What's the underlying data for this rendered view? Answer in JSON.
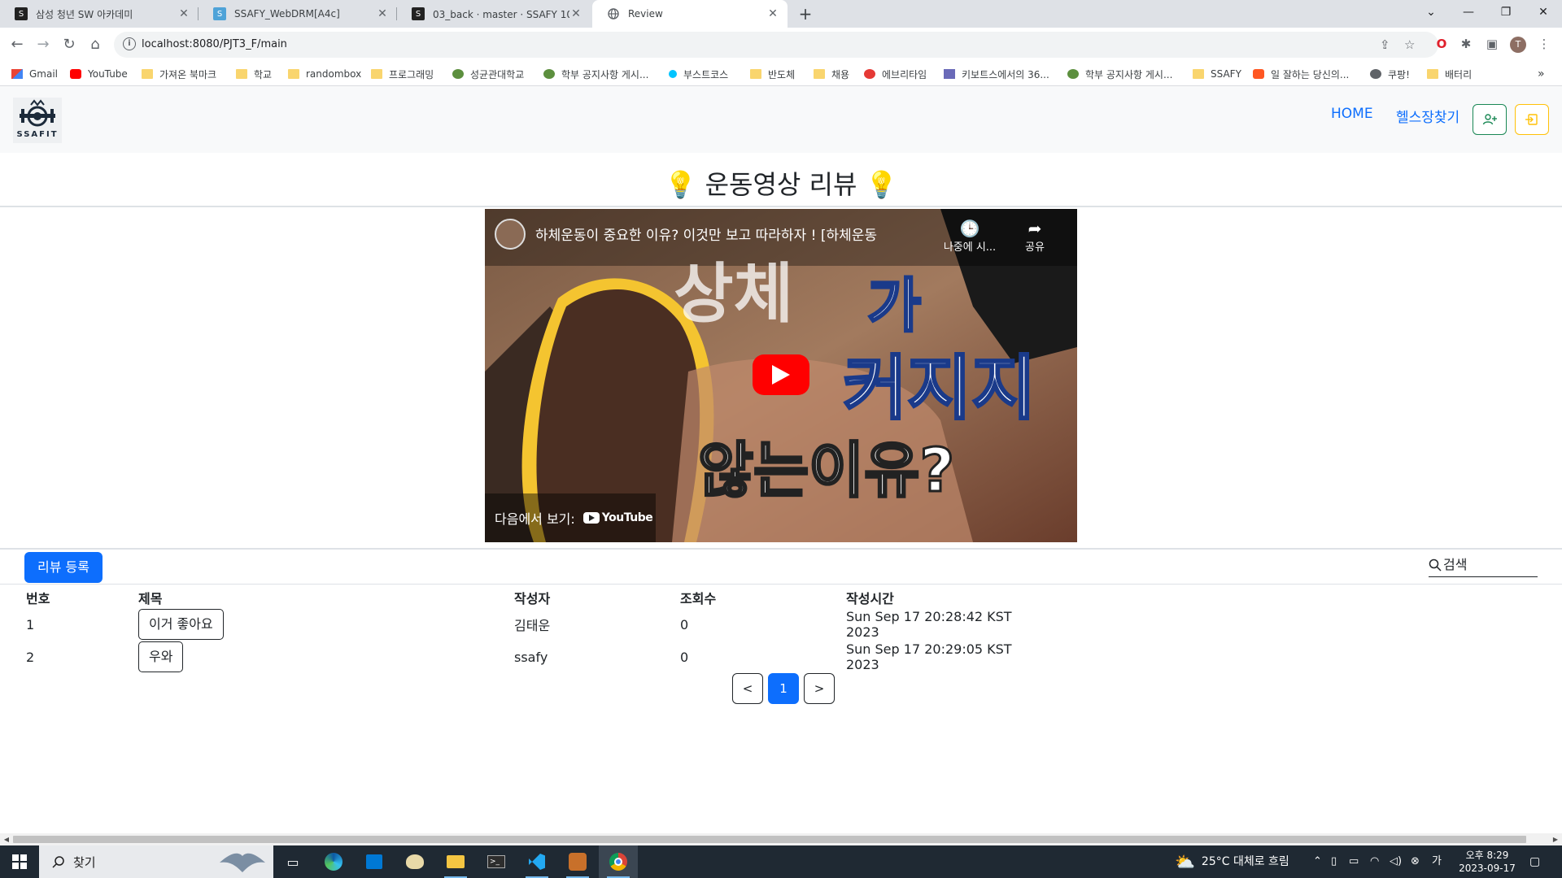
{
  "browser": {
    "tabs": [
      {
        "label": "삼성 청년 SW 아카데미"
      },
      {
        "label": "SSAFY_WebDRM[A4c]"
      },
      {
        "label": "03_back · master · SSAFY 10기 /"
      },
      {
        "label": "Review"
      }
    ],
    "url": "localhost:8080/PJT3_F/main",
    "profile_initial": "T",
    "bookmarks": [
      "Gmail",
      "YouTube",
      "가져온 북마크",
      "학교",
      "randombox",
      "프로그래밍",
      "성균관대학교",
      "학부 공지사항 게시...",
      "부스트코스",
      "반도체",
      "채용",
      "에브리타임",
      "키보트스에서의 36...",
      "학부 공지사항 게시...",
      "SSAFY",
      "일 잘하는 당신의...",
      "쿠팡!",
      "배터리"
    ]
  },
  "navbar": {
    "logo_text": "SSAFIT",
    "links": {
      "home": "HOME",
      "gym": "헬스장찾기"
    },
    "signup_icon": "person-plus-icon",
    "login_icon": "box-arrow-in-icon",
    "colors": {
      "signup": "#198754",
      "login": "#ffc107",
      "link": "#0d6efd"
    }
  },
  "review": {
    "title": "💡 운동영상 리뷰 💡"
  },
  "video": {
    "title": "하체운동이 중요한 이유? 이것만 보고 따라하자 ! [하체운동 ...",
    "watch_later": "나중에 시...",
    "share": "공유",
    "overlay_line1a": "상체",
    "overlay_line1b": "가",
    "overlay_line2": "커지지",
    "overlay_line3": "않는이유?",
    "watch_on": "다음에서 보기:",
    "youtube_brand": "YouTube"
  },
  "actions": {
    "register_label": "리뷰 등록",
    "search_placeholder": "검색",
    "primary_color": "#0d6efd"
  },
  "table": {
    "headers": {
      "no": "번호",
      "title": "제목",
      "writer": "작성자",
      "views": "조회수",
      "time": "작성시간"
    },
    "rows": [
      {
        "no": "1",
        "title": "이거 좋아요",
        "writer": "김태운",
        "views": "0",
        "time": "Sun Sep 17 20:28:42 KST 2023"
      },
      {
        "no": "2",
        "title": "우와",
        "writer": "ssafy",
        "views": "0",
        "time": "Sun Sep 17 20:29:05 KST 2023"
      }
    ]
  },
  "pagination": {
    "prev": "<",
    "current": "1",
    "next": ">"
  },
  "taskbar": {
    "search_label": "찾기",
    "weather": "25°C  대체로 흐림",
    "time": "오후 8:29",
    "date": "2023-09-17"
  }
}
